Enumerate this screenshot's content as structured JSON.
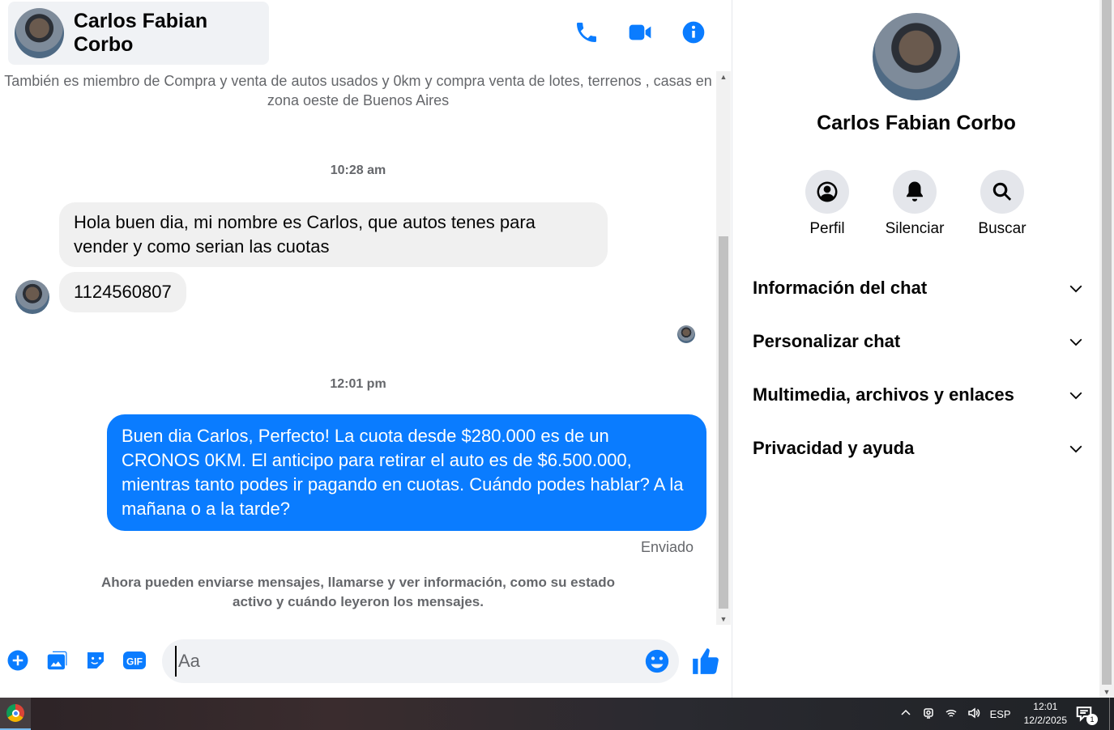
{
  "contact": {
    "name": "Carlos Fabian Corbo"
  },
  "header_actions": {
    "call": "phone-icon",
    "video": "video-icon",
    "info": "info-icon"
  },
  "messages": {
    "group_notice": "También es miembro de Compra y venta de autos usados y 0km y compra venta de lotes, terrenos , casas en zona oeste de Buenos Aires",
    "timestamp_1": "10:28 am",
    "incoming_1": "Hola buen dia, mi nombre es Carlos, que autos tenes para vender y como serian las cuotas",
    "incoming_2": "1124560807",
    "timestamp_2": "12:01 pm",
    "outgoing_1": "Buen dia Carlos, Perfecto! La cuota desde $280.000 es de un CRONOS 0KM. El anticipo para retirar el auto es de $6.500.000, mientras tanto podes ir pagando en cuotas. Cuándo podes hablar? A la mañana o a la tarde?",
    "outgoing_status": "Enviado",
    "connection_notice": "Ahora pueden enviarse mensajes, llamarse y ver información, como su estado activo y cuándo leyeron los mensajes."
  },
  "composer": {
    "placeholder": "Aa",
    "gif_label": "GIF"
  },
  "info_panel": {
    "name": "Carlos Fabian Corbo",
    "quick_actions": [
      {
        "label": "Perfil",
        "icon": "profile-icon"
      },
      {
        "label": "Silenciar",
        "icon": "bell-icon"
      },
      {
        "label": "Buscar",
        "icon": "search-icon"
      }
    ],
    "sections": [
      {
        "title": "Información del chat"
      },
      {
        "title": "Personalizar chat"
      },
      {
        "title": "Multimedia, archivos y enlaces"
      },
      {
        "title": "Privacidad y ayuda"
      }
    ]
  },
  "taskbar": {
    "language": "ESP",
    "time": "12:01",
    "date": "12/2/2025",
    "notification_count": "1"
  },
  "colors": {
    "accent": "#0a7cff",
    "bubble_in": "#f0f0f0",
    "muted_text": "#65676b"
  }
}
